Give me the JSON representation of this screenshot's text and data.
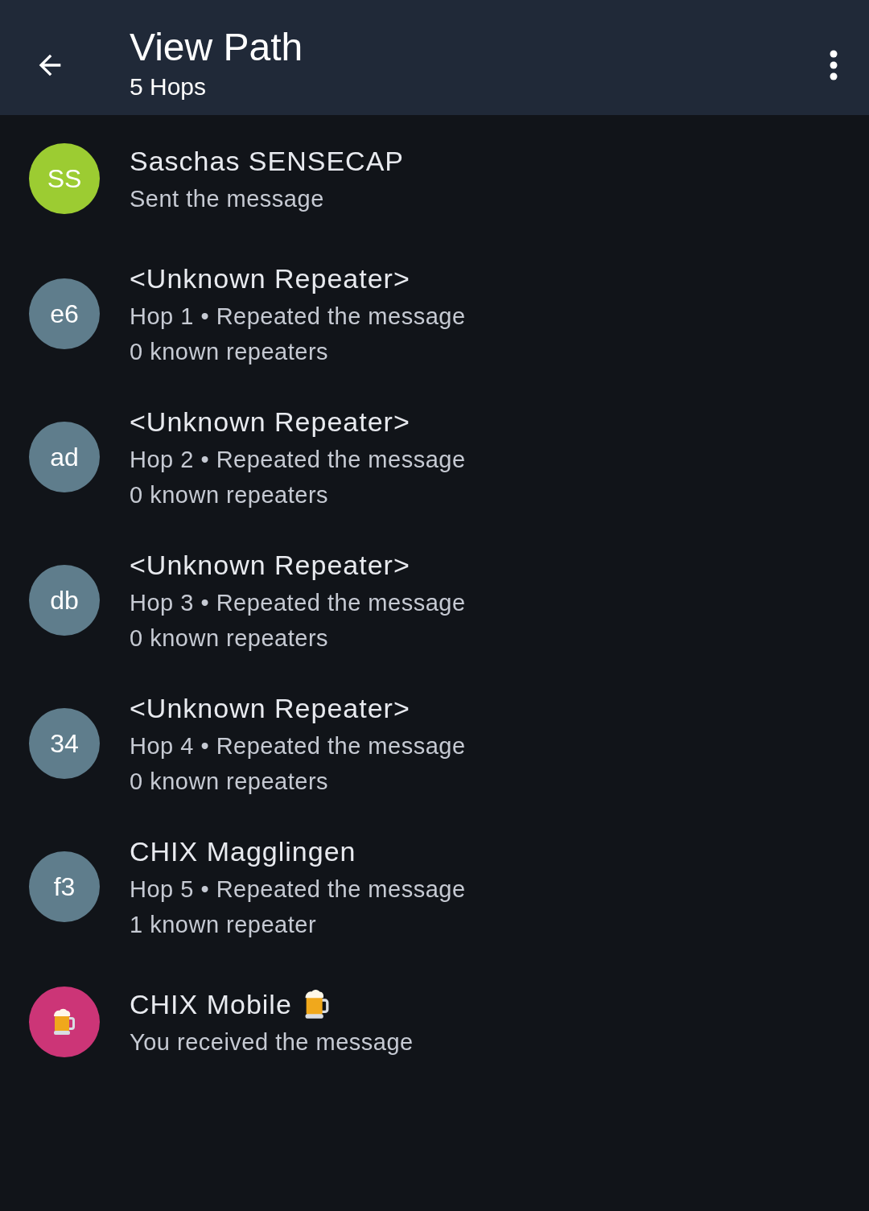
{
  "app_bar": {
    "title": "View Path",
    "subtitle": "5 Hops"
  },
  "hops": [
    {
      "avatar": {
        "kind": "text",
        "text": "SS",
        "color": "#9ccc32"
      },
      "name": "Saschas SENSECAP",
      "name_icon": false,
      "lines": [
        "Sent the message"
      ]
    },
    {
      "avatar": {
        "kind": "text",
        "text": "e6",
        "color": "#5f7d8c"
      },
      "name": "<Unknown Repeater>",
      "name_icon": false,
      "lines": [
        "Hop 1 • Repeated the message",
        "0 known repeaters"
      ]
    },
    {
      "avatar": {
        "kind": "text",
        "text": "ad",
        "color": "#5f7d8c"
      },
      "name": "<Unknown Repeater>",
      "name_icon": false,
      "lines": [
        "Hop 2 • Repeated the message",
        "0 known repeaters"
      ]
    },
    {
      "avatar": {
        "kind": "text",
        "text": "db",
        "color": "#5f7d8c"
      },
      "name": "<Unknown Repeater>",
      "name_icon": false,
      "lines": [
        "Hop 3 • Repeated the message",
        "0 known repeaters"
      ]
    },
    {
      "avatar": {
        "kind": "text",
        "text": "34",
        "color": "#5f7d8c"
      },
      "name": "<Unknown Repeater>",
      "name_icon": false,
      "lines": [
        "Hop 4 • Repeated the message",
        "0 known repeaters"
      ]
    },
    {
      "avatar": {
        "kind": "text",
        "text": "f3",
        "color": "#5f7d8c"
      },
      "name": "CHIX Magglingen",
      "name_icon": false,
      "lines": [
        "Hop 5 • Repeated the message",
        "1 known repeater"
      ]
    },
    {
      "avatar": {
        "kind": "icon",
        "color": "#cc3577"
      },
      "name": "CHIX Mobile",
      "name_icon": true,
      "lines": [
        "You received the message"
      ]
    }
  ]
}
